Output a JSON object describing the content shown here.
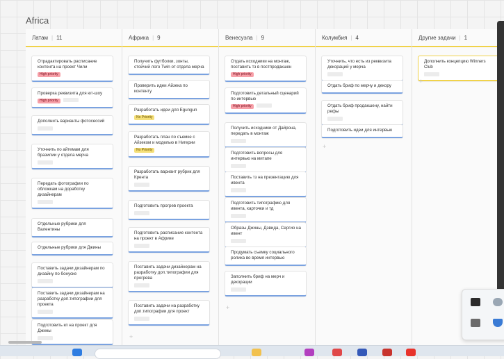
{
  "board": {
    "title": "Africa"
  },
  "columns": [
    {
      "name": "Латам",
      "count": "11",
      "cards": [
        {
          "text": "Отрадактировать расписание контента на проект Чили",
          "badge": "High priority",
          "badge_type": "high"
        },
        {
          "text": "Проверка реквизита для ют-шоу",
          "badge": "High priority",
          "badge_type": "high"
        },
        {
          "text": "Дополнить варианты фотосессий"
        },
        {
          "text": "Уточнить по айтемам для бразилии у отдела мерча"
        },
        {
          "text": "Передать фотографии по обложкам на доработку дизайнерам"
        },
        {
          "text": "Отдельные рубрики для Валентины"
        },
        {
          "text": "Отдельные рубрики для Джины"
        },
        {
          "text": "Поставить задачи дизайнерам по дизайну по бонуске"
        },
        {
          "text": "Поставить задачи дизайнерам на разработку доп.типографии для проекта"
        },
        {
          "text": "Подготовить кп на проект для Джины"
        }
      ]
    },
    {
      "name": "Африка",
      "count": "9",
      "cards": [
        {
          "text": "Получить футболки, зонты, стойчий лого Twin от отдела мерча"
        },
        {
          "text": "Проверить идеи Айзека по контенту"
        },
        {
          "text": "Разработать идеи для Egungun",
          "badge": "No Priority",
          "badge_type": "no"
        },
        {
          "text": "Разработать план по съемке с Айзеком и моделью в Нигерии",
          "badge": "No Priority",
          "badge_type": "no"
        },
        {
          "text": "Разработать вариант рубрик для Крента"
        },
        {
          "text": "Подготовить прогрев проекта"
        },
        {
          "text": "Подготовить расписание контента на проект в Африке"
        },
        {
          "text": "Поставить задачи дизайнерам на разработку доп.типографии для прогрева"
        },
        {
          "text": "Поставить задачи на разработку доп.типографии для проект"
        }
      ]
    },
    {
      "name": "Венесуэла",
      "count": "9",
      "cards": [
        {
          "text": "Отдать исходники на монтаж, поставить тз в постпродакшен",
          "badge": "High priority",
          "badge_type": "high"
        },
        {
          "text": "Подготовить детальный сценарий по интервью",
          "badge": "High priority",
          "badge_type": "high"
        },
        {
          "text": "Получить исходники от Дайрона, передать в монтаж"
        },
        {
          "text": "Подготовить вопросы для интервью на митапе"
        },
        {
          "text": "Поставить тз на презентацию для ивента"
        },
        {
          "text": "Подготовить типографию для ивента, карточки и тд"
        },
        {
          "text": "Образы Джины, Дэвида, Сергио на ивент"
        },
        {
          "text": "Продумать съемку социального ролика во время интервью"
        },
        {
          "text": "Заполнить бриф на мерч и декорации"
        }
      ]
    },
    {
      "name": "Колумбия",
      "count": "4",
      "cards": [
        {
          "text": "Уточнить, что есть из реквизита декораций у мерча"
        },
        {
          "text": "Отдать бриф по мерчу и декору"
        },
        {
          "text": "Отдать бриф продакшену, найти рефы"
        },
        {
          "text": "Подготовить идеи для интервью"
        }
      ]
    },
    {
      "name": "Другие задачи",
      "count": "1",
      "cards": [
        {
          "text": "Дополнить концепцию Winners Club"
        }
      ]
    }
  ],
  "add_symbol": "+",
  "colors": {
    "accent_yellow": "#f0d24a",
    "card_border": "#7aa2e0",
    "high": "#f7a0a8",
    "no": "#f5e07a"
  }
}
